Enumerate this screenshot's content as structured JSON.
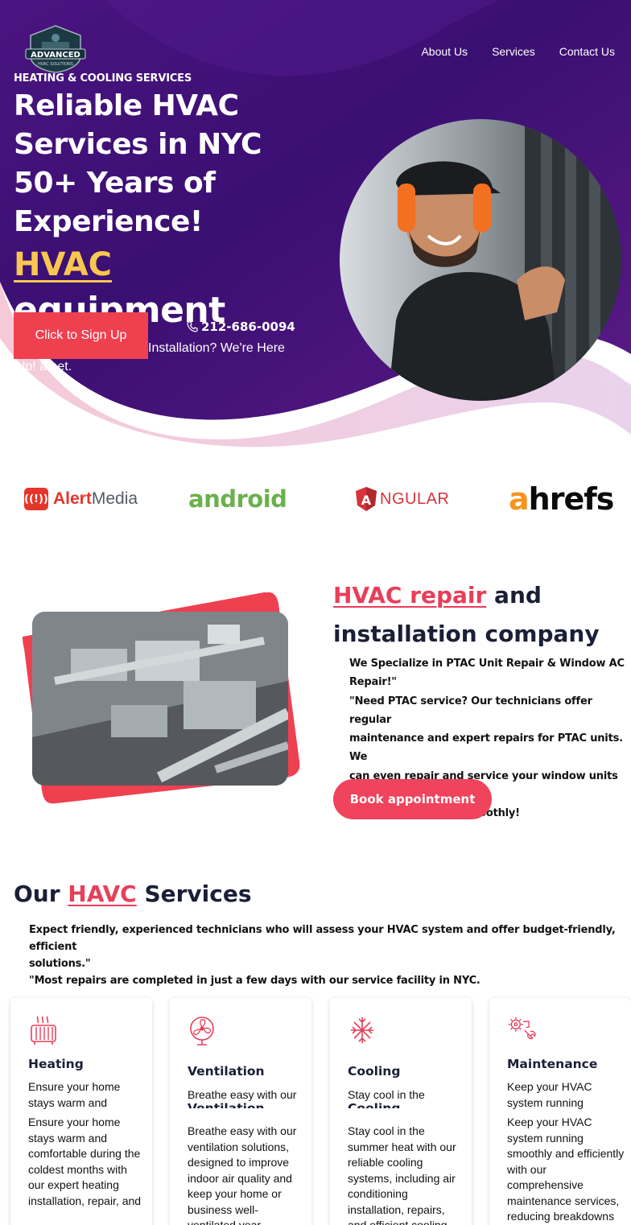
{
  "brand": {
    "logo_text": "ADVANCED",
    "logo_subtext": "HVAC SOLUTIONS"
  },
  "nav": {
    "items": [
      "About Us",
      "Services",
      "Contact Us"
    ]
  },
  "hero": {
    "eyebrow": "HEATING & COOLING SERVICES",
    "headline_lines": [
      "Reliable HVAC",
      "Services in NYC",
      "50+ Years of",
      "Experience!"
    ],
    "accent_word": "HVAC",
    "rotating_word": "equipment",
    "phone": "212-686-0094",
    "tagline_lines": [
      "Installation? We're Here",
      "o Help! amet."
    ],
    "cta_label": "Click to Sign Up",
    "colors": {
      "bg_dark": "#2a0e58",
      "bg_mid": "#5a1a8a",
      "accent_yellow": "#f9c74f",
      "cta_red": "#ef4050"
    }
  },
  "brands": {
    "alertmedia": {
      "part1": "Alert",
      "part2": "Media"
    },
    "android": "android",
    "angular": "NGULAR",
    "angular_mark": "A",
    "ahrefs": {
      "a": "a",
      "rest": "hrefs"
    }
  },
  "about": {
    "title_accent": "HVAC repair",
    "title_rest": " and installation company",
    "body_lines": [
      "We Specialize in PTAC Unit Repair & Window AC",
      "Repair!\"",
      "\"Need PTAC service? Our technicians offer regular",
      "maintenance and expert repairs for PTAC units. We",
      "can even repair and service your window units to",
      "keep them running smoothly!"
    ],
    "cta_label": "Book appointment",
    "accent_color": "#e83e5a"
  },
  "services": {
    "title_pre": "Our ",
    "title_accent": "HAVC",
    "title_post": " Services",
    "intro_lines": [
      "Expect friendly, experienced technicians who will assess your HVAC system and offer budget-friendly, efficient",
      "solutions.\"",
      "\"Most repairs are completed in just a few days with our service facility in NYC."
    ],
    "cards": [
      {
        "icon": "heater-icon",
        "title": "Heating",
        "short": "Ensure your home stays warm and",
        "long": "Ensure your home stays warm and comfortable during the coldest months with our expert heating installation, repair, and"
      },
      {
        "icon": "fan-icon",
        "title": "Ventilation",
        "short": "Breathe easy with our",
        "long": "Breathe easy with our ventilation solutions, designed to improve indoor air quality and keep your home or business well-ventilated year"
      },
      {
        "icon": "snowflake-icon",
        "title": "Cooling",
        "short": "Stay cool in the",
        "long": "Stay cool in the summer heat with our reliable cooling systems, including air conditioning installation, repairs, and efficient cooling"
      },
      {
        "icon": "gear-wrench-icon",
        "title": "Maintenance",
        "short": "Keep your HVAC system running",
        "long": "Keep your HVAC system running smoothly and efficiently with our comprehensive maintenance services, reducing breakdowns"
      }
    ]
  }
}
